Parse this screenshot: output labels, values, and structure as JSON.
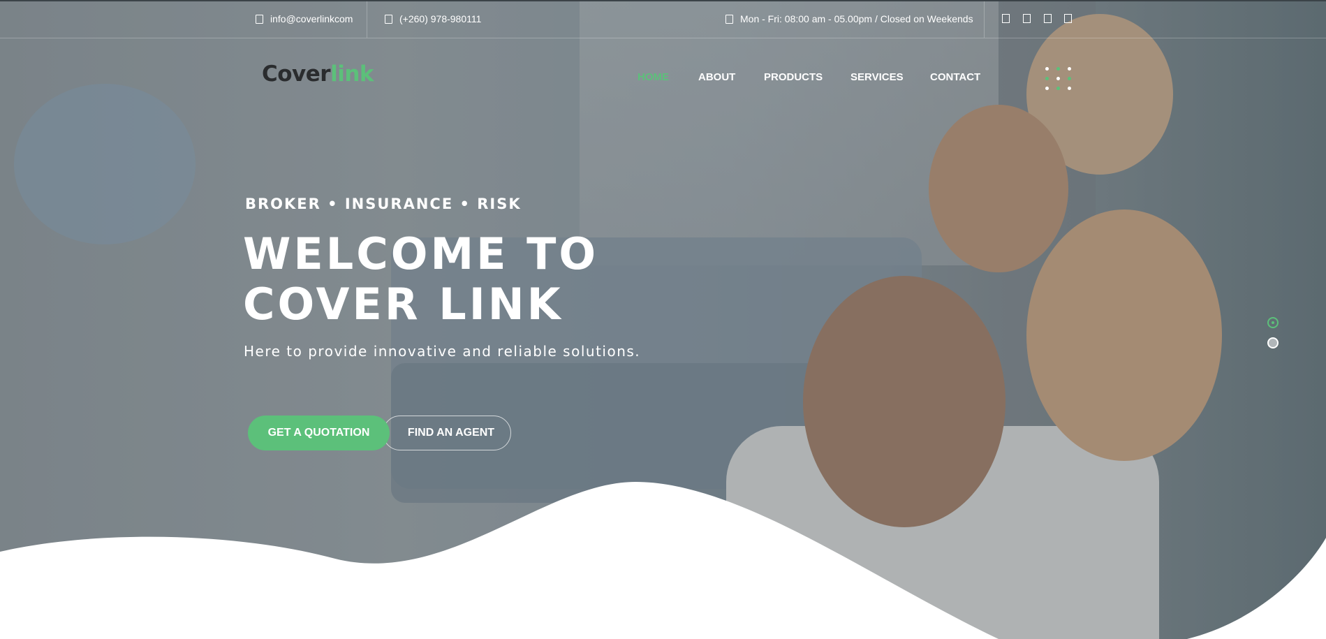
{
  "topbar": {
    "email": "info@coverlinkcom",
    "phone": "(+260) 978-980111",
    "hours": "Mon - Fri: 08:00 am - 05.00pm / Closed on Weekends",
    "social_icons": [
      "facebook-icon",
      "twitter-icon",
      "linkedin-icon",
      "instagram-icon"
    ]
  },
  "logo": {
    "part1": "Cover",
    "part2": "link"
  },
  "nav": [
    {
      "label": "HOME",
      "active": true
    },
    {
      "label": "ABOUT"
    },
    {
      "label": "PRODUCTS"
    },
    {
      "label": "SERVICES"
    },
    {
      "label": "CONTACT"
    }
  ],
  "hero": {
    "subhead": "BROKER • INSURANCE • RISK",
    "headline_line1": "WELCOME TO",
    "headline_line2": "COVER LINK",
    "tagline": "Here to provide innovative and reliable solutions.",
    "primary_button": "GET A QUOTATION",
    "secondary_button": "FIND AN AGENT"
  },
  "slider": {
    "slides": 2,
    "active": 1
  },
  "colors": {
    "accent": "#5cc07a",
    "text": "#ffffff",
    "logo_dark": "#2a2c2e"
  }
}
